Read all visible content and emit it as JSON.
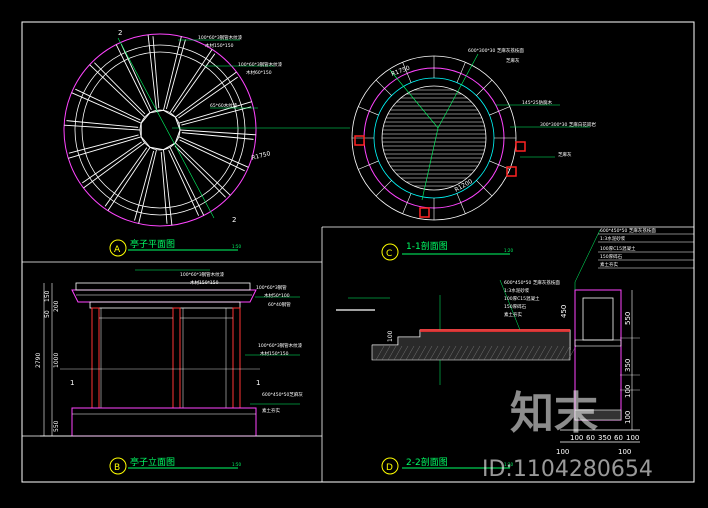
{
  "drawing": {
    "panels": {
      "a": {
        "letter": "A",
        "title": "亭子平面图",
        "scale": "1:50"
      },
      "b": {
        "letter": "B",
        "title": "亭子立面图",
        "scale": "1:50"
      },
      "c": {
        "letter": "C",
        "title": "1-1剖面图",
        "scale": "1:20"
      },
      "d": {
        "letter": "D",
        "title": "2-2剖面图",
        "scale": "1:20"
      }
    },
    "plan_a": {
      "radius_label": "R1750",
      "section_mark": "2",
      "notes": [
        "100*60*3钢管木纹漆",
        "木材150*150",
        "100*60*3钢管木纹漆",
        "木材60*150",
        "65*60木纹漆"
      ]
    },
    "plan_c": {
      "notes": [
        "600*300*30 芝麻灰荔枝面",
        "芝麻灰",
        "145*25防腐木",
        "300*300*30 芝麻白花岗岩",
        "芝麻灰"
      ],
      "dims": [
        "R1750",
        "R1200"
      ]
    },
    "elev_b": {
      "dims_vertical": [
        "2790",
        "150",
        "50",
        "200",
        "1000",
        "550"
      ],
      "notes": [
        "100*60*3钢管木纹漆",
        "木材150*150",
        "100*60*3钢管",
        "木材50*100",
        "60*40钢管",
        "100*60*3钢管木纹漆",
        "木材150*150",
        "600*450*50芝麻灰",
        "素土夯实"
      ],
      "section_mark": "1"
    },
    "section_cd": {
      "layers": [
        "600*450*50 芝麻灰荔枝面",
        "1:3水泥砂浆",
        "100厚C15混凝土",
        "150厚碎石",
        "素土夯实"
      ],
      "dims": [
        "550",
        "350",
        "100",
        "100",
        "450",
        "100"
      ],
      "bottom_dims": [
        "100",
        "60",
        "350",
        "60",
        "100"
      ],
      "bottom_dims2": [
        "100",
        "100"
      ]
    },
    "watermark": {
      "brand": "知末",
      "id_text": "ID:1104280654"
    }
  }
}
